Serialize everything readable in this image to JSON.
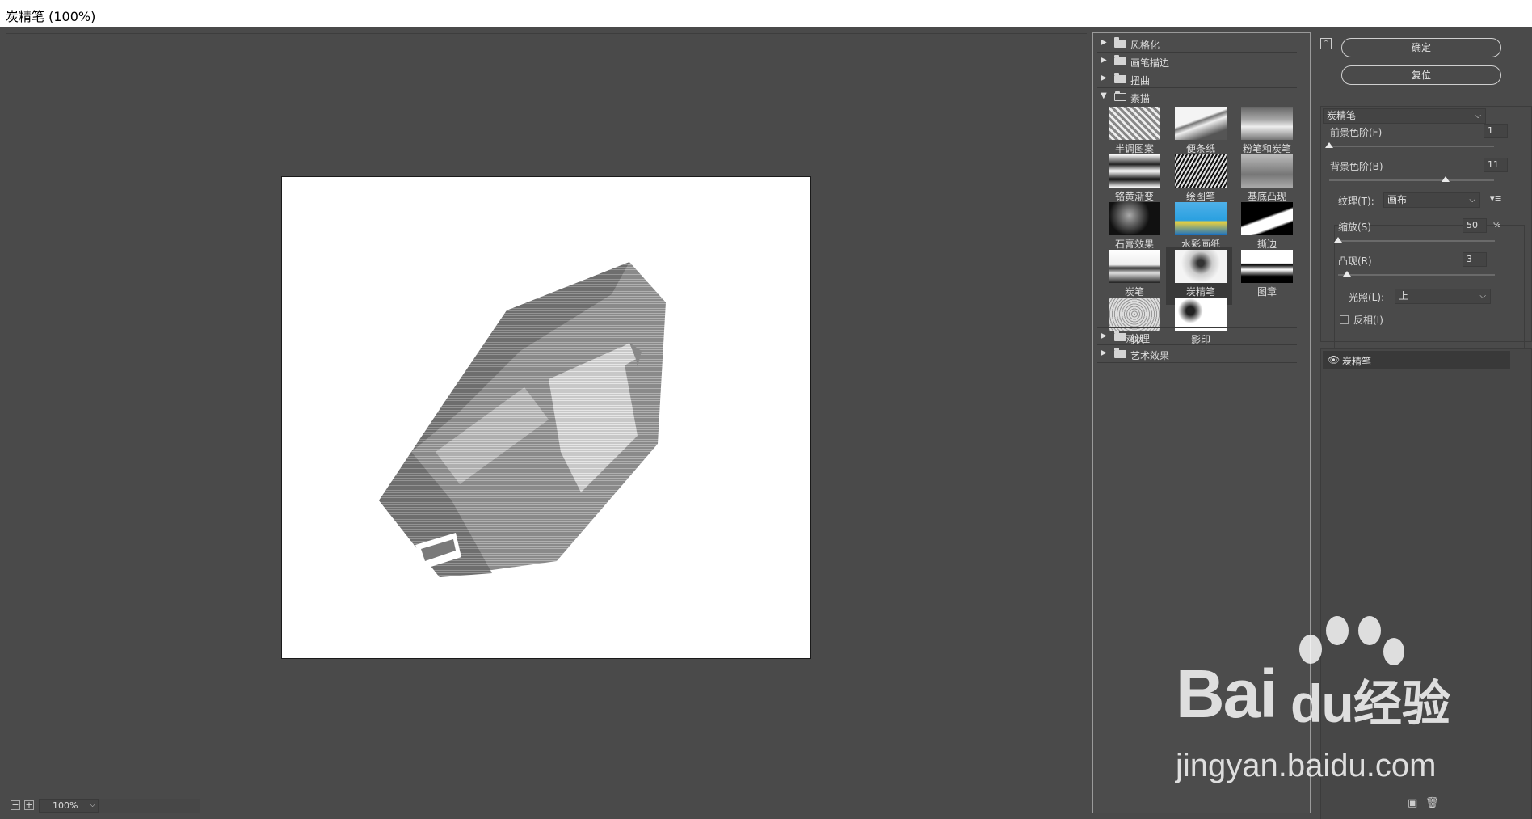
{
  "window": {
    "title": "炭精笔 (100%)"
  },
  "preview": {
    "zoom": "100%"
  },
  "gallery": {
    "categories_top": [
      {
        "label": "风格化",
        "expanded": false
      },
      {
        "label": "画笔描边",
        "expanded": false
      },
      {
        "label": "扭曲",
        "expanded": false
      },
      {
        "label": "素描",
        "expanded": true
      }
    ],
    "sketch_filters": [
      {
        "label": "半调图案"
      },
      {
        "label": "便条纸"
      },
      {
        "label": "粉笔和炭笔"
      },
      {
        "label": "铬黄渐变"
      },
      {
        "label": "绘图笔"
      },
      {
        "label": "基底凸现"
      },
      {
        "label": "石膏效果"
      },
      {
        "label": "水彩画纸"
      },
      {
        "label": "撕边"
      },
      {
        "label": "炭笔"
      },
      {
        "label": "炭精笔",
        "selected": true
      },
      {
        "label": "图章"
      },
      {
        "label": "网状"
      },
      {
        "label": "影印"
      }
    ],
    "categories_bottom": [
      {
        "label": "纹理",
        "expanded": false
      },
      {
        "label": "艺术效果",
        "expanded": false
      }
    ]
  },
  "panel": {
    "ok_label": "确定",
    "reset_label": "复位",
    "filter_select": "炭精笔",
    "foreground_level": {
      "label": "前景色阶(F)",
      "value": "1",
      "fraction": 0.0
    },
    "background_level": {
      "label": "背景色阶(B)",
      "value": "11",
      "fraction": 0.71
    },
    "texture": {
      "label": "纹理(T):",
      "value": "画布"
    },
    "scaling": {
      "label": "缩放(S)",
      "value": "50",
      "unit": "%",
      "fraction": 0.0
    },
    "relief": {
      "label": "凸现(R)",
      "value": "3",
      "fraction": 0.06
    },
    "light": {
      "label": "光照(L):",
      "value": "上"
    },
    "invert": {
      "label": "反相(I)",
      "checked": false
    },
    "layer": {
      "name": "炭精笔"
    }
  },
  "watermark": {
    "logo_text": "Bai",
    "logo_text2": "du",
    "cn_text": "经验",
    "url": "jingyan.baidu.com"
  }
}
